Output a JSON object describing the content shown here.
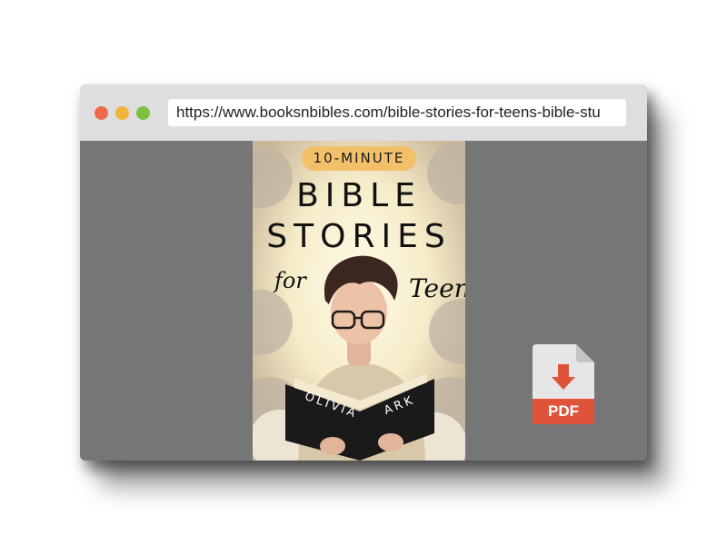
{
  "browser": {
    "url": "https://www.booksnbibles.com/bible-stories-for-teens-bible-stu",
    "window_controls": {
      "close_color": "#ee6a4c",
      "minimize_color": "#f0b43a",
      "maximize_color": "#7cc03e"
    }
  },
  "book_cover": {
    "badge": "10-MINUTE",
    "title_line_1": "BIBLE",
    "title_line_2": "STORIES",
    "script_for": "for",
    "script_teens": "Teens",
    "author_first": "OLIVIA",
    "author_last": "ARK"
  },
  "download": {
    "icon": "pdf-download-icon",
    "label": "PDF",
    "accent_color": "#e0533b"
  }
}
